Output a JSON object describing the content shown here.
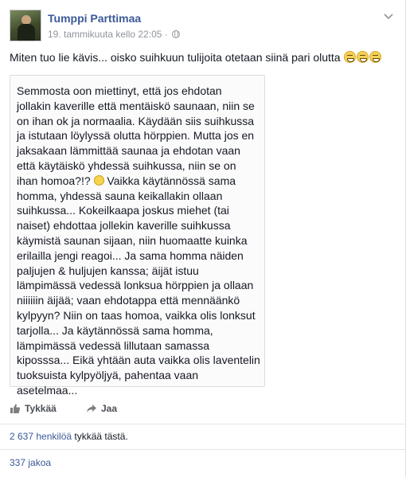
{
  "post": {
    "author": "Tumppi Parttimaa",
    "timestamp": "19. tammikuuta kello 22:05",
    "separator": "·",
    "privacy_icon": "globe-icon",
    "menu_icon": "chevron-down-icon",
    "message": "Miten tuo lie kävis... oisko suihkuun tulijoita otetaan siinä pari olutta",
    "message_emojis": [
      "grinning-squint-emoji",
      "grinning-squint-emoji",
      "grinning-squint-emoji"
    ],
    "quoted_text": [
      "Semmosta oon miettinyt, että jos ehdotan",
      "jollakin kaverille että mentäiskö saunaan, niin se",
      "on ihan ok ja normaalia. Käydään siis suihkussa",
      "ja istutaan löylyssä olutta hörppien. Mutta jos en",
      "jaksakaan lämmittää saunaa ja ehdotan vaan",
      "että käytäiskö yhdessä suihkussa, niin se on",
      "ihan homoa?!?",
      "Vaikka käytännössä sama",
      "homma, yhdessä sauna keikallakin ollaan",
      "suihkussa... Kokeilkaapa joskus miehet (tai",
      "naiset) ehdottaa jollekin kaverille suihkussa",
      "käymistä saunan sijaan, niin huomaatte kuinka",
      "erilailla jengi reagoi... Ja sama homma näiden",
      "paljujen & huljujen kanssa; äijät istuu",
      "lämpimässä vedessä lonksua hörppien ja ollaan",
      "niiiiiin äijää; vaan ehdotappa että mennäänkö",
      "kylpyyn? Niin on taas homoa, vaikka olis lonksut",
      "tarjolla... Ja käytännössä sama homma,",
      "lämpimässä vedessä lillutaan samassa",
      "kiposssa... Eikä yhtään auta vaikka olis laventelin",
      "tuoksuista kylpyöljyä, pahentaa vaan",
      "asetelmaa..."
    ],
    "inline_smiley_icon": "smiley-icon"
  },
  "actions": {
    "like_label": "Tykkää",
    "like_icon": "thumbs-up-icon",
    "share_label": "Jaa",
    "share_icon": "share-arrow-icon"
  },
  "stats": {
    "likes_count_link": "2 637 henkilöä",
    "likes_suffix": " tykkää tästä.",
    "shares": "337 jakoa"
  },
  "colors": {
    "link": "#3b5998",
    "meta": "#90949c",
    "text": "#141823"
  }
}
